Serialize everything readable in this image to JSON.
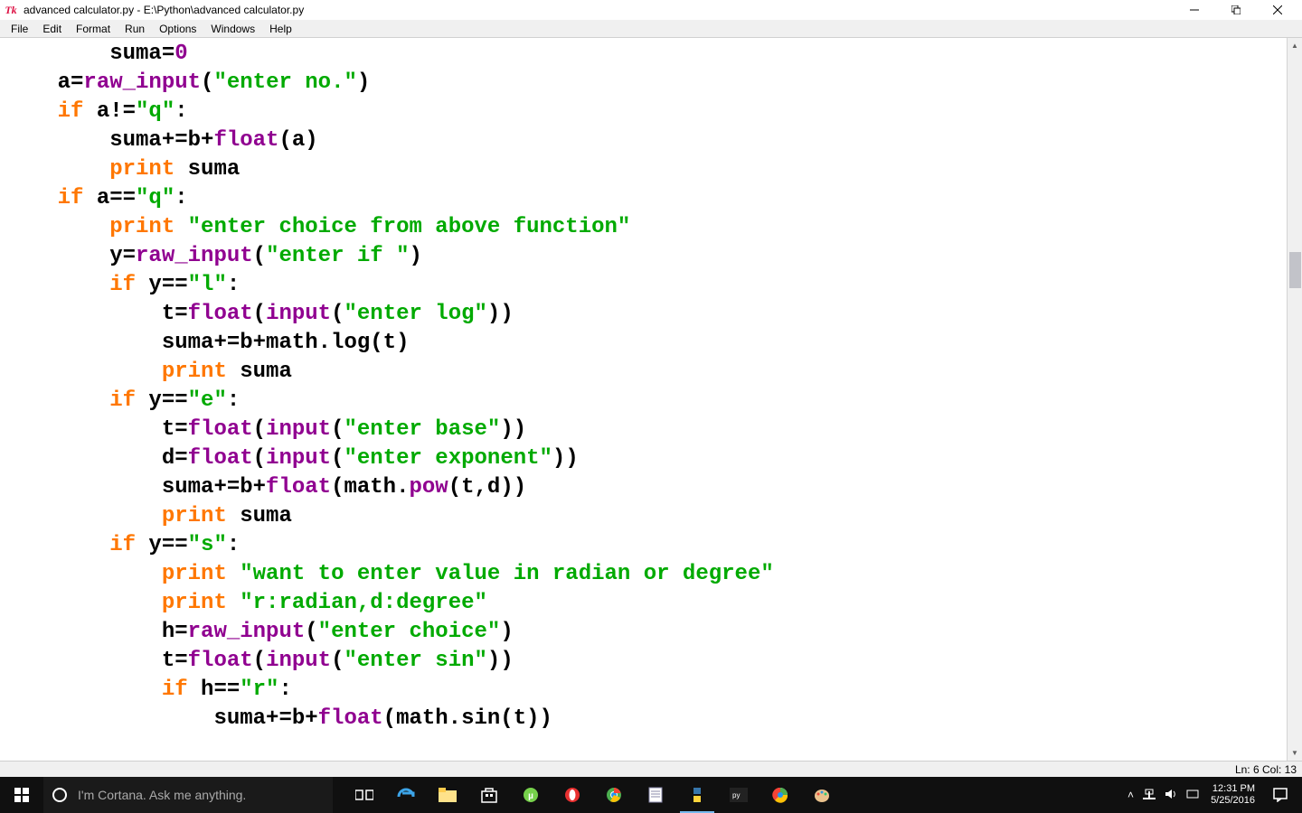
{
  "titlebar": {
    "icon_label": "Tk",
    "title": "advanced calculator.py - E:\\Python\\advanced calculator.py"
  },
  "menubar": {
    "items": [
      "File",
      "Edit",
      "Format",
      "Run",
      "Options",
      "Windows",
      "Help"
    ]
  },
  "statusbar": {
    "text": "Ln: 6 Col: 13"
  },
  "code": {
    "tokens": [
      [
        [
          "p",
          "        suma="
        ],
        [
          "b",
          "0"
        ]
      ],
      [
        [
          "p",
          "    a="
        ],
        [
          "b",
          "raw_input"
        ],
        [
          "p",
          "("
        ],
        [
          "s",
          "\"enter no.\""
        ],
        [
          "p",
          ")"
        ]
      ],
      [
        [
          "p",
          "    "
        ],
        [
          "k",
          "if"
        ],
        [
          "p",
          " a!="
        ],
        [
          "s",
          "\"q\""
        ],
        [
          "p",
          ":"
        ]
      ],
      [
        [
          "p",
          "        suma+=b+"
        ],
        [
          "b",
          "float"
        ],
        [
          "p",
          "(a)"
        ]
      ],
      [
        [
          "p",
          "        "
        ],
        [
          "k",
          "print"
        ],
        [
          "p",
          " suma"
        ]
      ],
      [
        [
          "p",
          "    "
        ],
        [
          "k",
          "if"
        ],
        [
          "p",
          " a=="
        ],
        [
          "s",
          "\"q\""
        ],
        [
          "p",
          ":"
        ]
      ],
      [
        [
          "p",
          "        "
        ],
        [
          "k",
          "print"
        ],
        [
          "p",
          " "
        ],
        [
          "s",
          "\"enter choice from above function\""
        ]
      ],
      [
        [
          "p",
          "        y="
        ],
        [
          "b",
          "raw_input"
        ],
        [
          "p",
          "("
        ],
        [
          "s",
          "\"enter if \""
        ],
        [
          "p",
          ")"
        ]
      ],
      [
        [
          "p",
          "        "
        ],
        [
          "k",
          "if"
        ],
        [
          "p",
          " y=="
        ],
        [
          "s",
          "\"l\""
        ],
        [
          "p",
          ":"
        ]
      ],
      [
        [
          "p",
          "            t="
        ],
        [
          "b",
          "float"
        ],
        [
          "p",
          "("
        ],
        [
          "b",
          "input"
        ],
        [
          "p",
          "("
        ],
        [
          "s",
          "\"enter log\""
        ],
        [
          "p",
          "))"
        ]
      ],
      [
        [
          "p",
          "            suma+=b+math.log(t)"
        ]
      ],
      [
        [
          "p",
          "            "
        ],
        [
          "k",
          "print"
        ],
        [
          "p",
          " suma"
        ]
      ],
      [
        [
          "p",
          "        "
        ],
        [
          "k",
          "if"
        ],
        [
          "p",
          " y=="
        ],
        [
          "s",
          "\"e\""
        ],
        [
          "p",
          ":"
        ]
      ],
      [
        [
          "p",
          "            t="
        ],
        [
          "b",
          "float"
        ],
        [
          "p",
          "("
        ],
        [
          "b",
          "input"
        ],
        [
          "p",
          "("
        ],
        [
          "s",
          "\"enter base\""
        ],
        [
          "p",
          "))"
        ]
      ],
      [
        [
          "p",
          "            d="
        ],
        [
          "b",
          "float"
        ],
        [
          "p",
          "("
        ],
        [
          "b",
          "input"
        ],
        [
          "p",
          "("
        ],
        [
          "s",
          "\"enter exponent\""
        ],
        [
          "p",
          "))"
        ]
      ],
      [
        [
          "p",
          "            suma+=b+"
        ],
        [
          "b",
          "float"
        ],
        [
          "p",
          "(math."
        ],
        [
          "b",
          "pow"
        ],
        [
          "p",
          "(t,d))"
        ]
      ],
      [
        [
          "p",
          "            "
        ],
        [
          "k",
          "print"
        ],
        [
          "p",
          " suma"
        ]
      ],
      [
        [
          "p",
          "        "
        ],
        [
          "k",
          "if"
        ],
        [
          "p",
          " y=="
        ],
        [
          "s",
          "\"s\""
        ],
        [
          "p",
          ":"
        ]
      ],
      [
        [
          "p",
          "            "
        ],
        [
          "k",
          "print"
        ],
        [
          "p",
          " "
        ],
        [
          "s",
          "\"want to enter value in radian or degree\""
        ]
      ],
      [
        [
          "p",
          "            "
        ],
        [
          "k",
          "print"
        ],
        [
          "p",
          " "
        ],
        [
          "s",
          "\"r:radian,d:degree\""
        ]
      ],
      [
        [
          "p",
          "            h="
        ],
        [
          "b",
          "raw_input"
        ],
        [
          "p",
          "("
        ],
        [
          "s",
          "\"enter choice\""
        ],
        [
          "p",
          ")"
        ]
      ],
      [
        [
          "p",
          "            t="
        ],
        [
          "b",
          "float"
        ],
        [
          "p",
          "("
        ],
        [
          "b",
          "input"
        ],
        [
          "p",
          "("
        ],
        [
          "s",
          "\"enter sin\""
        ],
        [
          "p",
          "))"
        ]
      ],
      [
        [
          "p",
          "            "
        ],
        [
          "k",
          "if"
        ],
        [
          "p",
          " h=="
        ],
        [
          "s",
          "\"r\""
        ],
        [
          "p",
          ":"
        ]
      ],
      [
        [
          "p",
          "                suma+=b+"
        ],
        [
          "b",
          "float"
        ],
        [
          "p",
          "(math.sin(t))"
        ]
      ]
    ]
  },
  "taskbar": {
    "search_placeholder": "I'm Cortana. Ask me anything.",
    "clock_time": "12:31 PM",
    "clock_date": "5/25/2016",
    "tray_chevron": "˄"
  }
}
